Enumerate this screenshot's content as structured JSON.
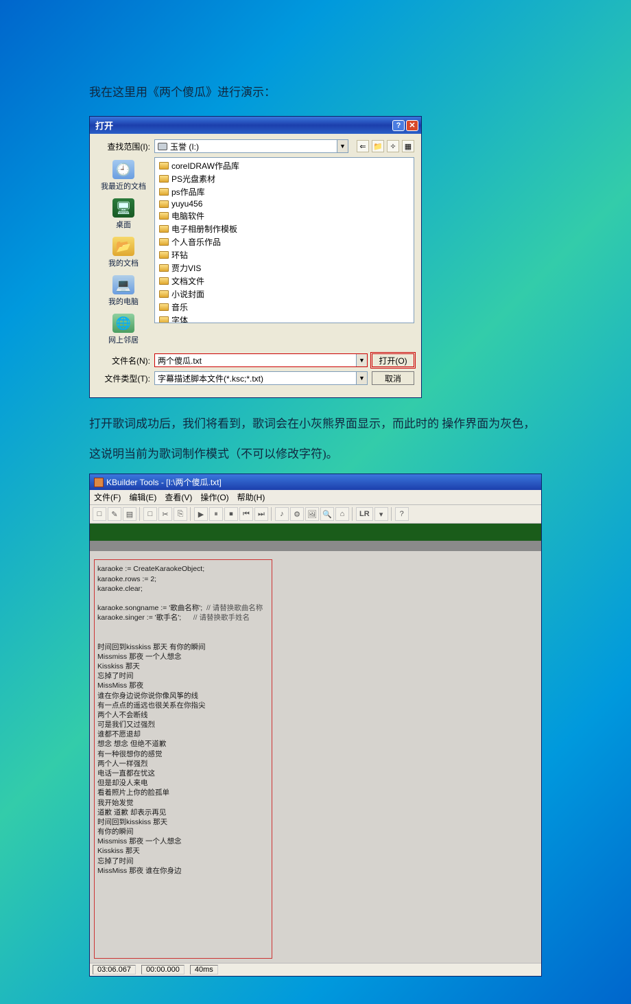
{
  "intro": "我在这里用《两个傻瓜》进行演示：",
  "paragraph": "打开歌词成功后，我们将看到，歌词会在小灰熊界面显示，而此时的 操作界面为灰色，这说明当前为歌词制作模式（不可以修改字符)。",
  "openDialog": {
    "title": "打开",
    "lookInLabel": "查找范围(I):",
    "driveName": "玉誉 (I:)",
    "navIcons": {
      "back": "⇐",
      "up": "📁",
      "new": "✧",
      "views": "▦"
    },
    "places": [
      {
        "label": "我最近的文档",
        "kind": "doc",
        "icon": "🕘"
      },
      {
        "label": "桌面",
        "kind": "desk",
        "icon": "🖥"
      },
      {
        "label": "我的文档",
        "kind": "mydoc",
        "icon": "📂"
      },
      {
        "label": "我的电脑",
        "kind": "comp",
        "icon": "💻"
      },
      {
        "label": "网上邻居",
        "kind": "net",
        "icon": "🌐"
      }
    ],
    "folders": [
      "coreIDRAW作品库",
      "PS光盘素材",
      "ps作品库",
      "yuyu456",
      "电脑软件",
      "电子相册制作模板",
      "个人音乐作品",
      "环钻",
      "贾力VIS",
      "文档文件",
      "小说封面",
      "音乐",
      "字体"
    ],
    "selectedFile": "两个傻瓜.txt",
    "filenameLabel": "文件名(N):",
    "filenameValue": "两个傻瓜.txt",
    "filetypeLabel": "文件类型(T):",
    "filetypeValue": "字幕描述脚本文件(*.ksc;*.txt)",
    "openBtn": "打开(O)",
    "cancelBtn": "取消"
  },
  "kbuilder": {
    "title": "KBuilder Tools - [I:\\两个傻瓜.txt]",
    "menus": [
      "文件(F)",
      "编辑(E)",
      "查看(V)",
      "操作(O)",
      "帮助(H)"
    ],
    "toolbarIcons": [
      "□",
      "✎",
      "▤",
      "│",
      "□",
      "✂",
      "⎘",
      "│",
      "▶",
      "⏸",
      "⏹",
      "⏮",
      "⏭",
      "│",
      "♪",
      "⚙",
      "🖼",
      "🔍",
      "⌂",
      "│",
      "LR",
      "▾",
      "│",
      "?"
    ],
    "script": {
      "lines": [
        "karaoke := CreateKaraokeObject;",
        "karaoke.rows := 2;",
        "karaoke.clear;",
        "",
        "karaoke.songname := '歌曲名称';  // 请替换歌曲名称",
        "karaoke.singer := '歌手名';      // 请替换歌手姓名",
        "",
        "",
        "时间回到kisskiss 那天 有你的瞬间",
        "Missmiss 那夜 一个人想念",
        "Kisskiss 那天",
        "忘掉了时间",
        "MissMiss 那夜",
        "谁在你身边说你说你像风筝的线",
        "有一点点的遥远也很关系在你指尖",
        "两个人不会断线",
        "可是我们又过强烈",
        "谁都不愿退却",
        "想念 想念 但绝不道歉",
        "有一种很想你的感觉",
        "两个人一样强烈",
        "电话一直都在忧这",
        "但是却没人来电",
        "看着照片上你的脸孤单",
        "我开始发觉",
        "道歉 道歉 却表示再见",
        "时间回到kisskiss 那天",
        "有你的瞬间",
        "Missmiss 那夜 一个人想念",
        "Kisskiss 那天",
        "忘掉了时间",
        "MissMiss 那夜 谁在你身边"
      ]
    },
    "status": {
      "time1": "03:06.067",
      "time2": "00:00.000",
      "ms": "40ms"
    }
  }
}
